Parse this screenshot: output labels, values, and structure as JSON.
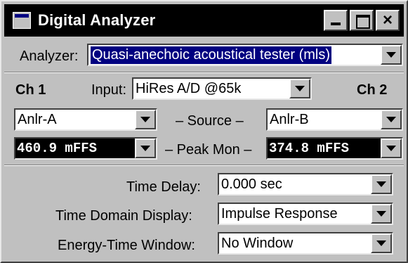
{
  "window": {
    "title": "Digital Analyzer",
    "close_glyph": "×"
  },
  "analyzer": {
    "label": "Analyzer:",
    "value": "Quasi-anechoic acoustical tester (mls)"
  },
  "channels": {
    "ch1_label": "Ch 1",
    "ch2_label": "Ch 2",
    "input_label": "Input:",
    "input_value": "HiRes A/D @65k"
  },
  "source": {
    "label": "– Source –",
    "ch1_value": "Anlr-A",
    "ch2_value": "Anlr-B"
  },
  "peak_mon": {
    "label": "– Peak Mon –",
    "ch1_value": "460.9  mFFS",
    "ch2_value": "374.8  mFFS"
  },
  "time_delay": {
    "label": "Time Delay:",
    "value": "0.000   sec"
  },
  "time_domain": {
    "label": "Time Domain Display:",
    "value": "Impulse Response"
  },
  "energy_time": {
    "label": "Energy-Time Window:",
    "value": "No Window"
  }
}
